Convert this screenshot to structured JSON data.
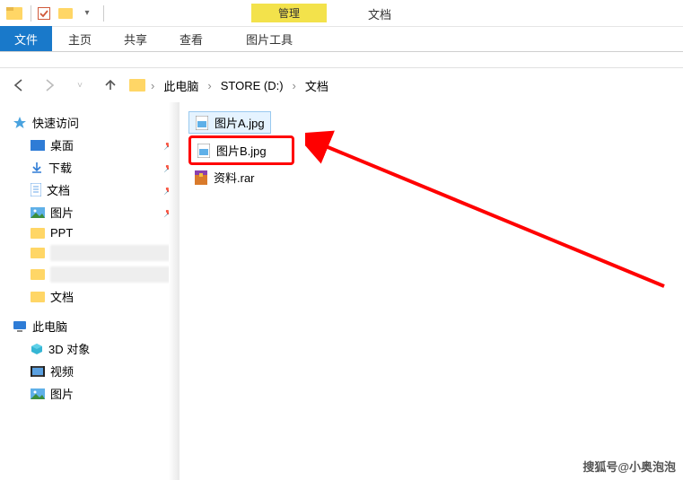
{
  "titlebar": {
    "doc_label": "文档"
  },
  "context": {
    "header": "管理",
    "tab": "图片工具"
  },
  "ribbon": {
    "file": "文件",
    "tabs": [
      "主页",
      "共享",
      "查看"
    ]
  },
  "breadcrumb": {
    "items": [
      "此电脑",
      "STORE (D:)",
      "文档"
    ]
  },
  "sidebar": {
    "quick_access": "快速访问",
    "desktop": "桌面",
    "downloads": "下载",
    "documents": "文档",
    "pictures": "图片",
    "ppt": "PPT",
    "documents2": "文档",
    "this_pc": "此电脑",
    "objects3d": "3D 对象",
    "videos": "视频",
    "pictures2": "图片"
  },
  "files": {
    "a": "图片A.jpg",
    "b": "图片B.jpg",
    "rar": "资料.rar"
  },
  "watermark": "搜狐号@小奥泡泡"
}
